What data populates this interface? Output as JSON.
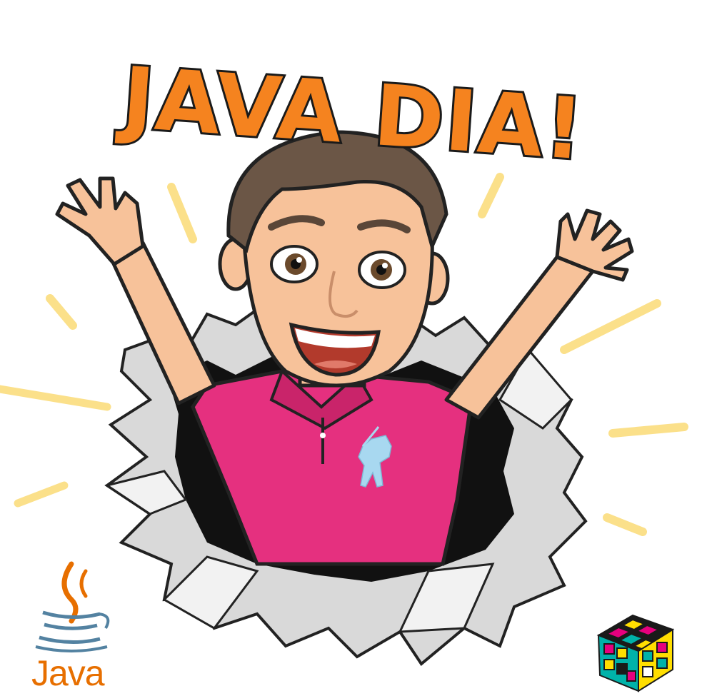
{
  "sticker": {
    "headline": "JAVA DIA!",
    "headline_color": "#f5831f",
    "shirt_color": "#e5307f",
    "polo_logo_color": "#a8d8f0",
    "ray_color": "#fbe08a",
    "paper_color": "#ffffff"
  },
  "java_logo": {
    "label": "Java",
    "cup_color": "#5382a1",
    "flame_color": "#e76f00",
    "icon": "java-coffee-cup-icon"
  },
  "corner_logo": {
    "icon": "rubiks-cube-icon",
    "colors": [
      "#e6007e",
      "#ffde00",
      "#00b2a9",
      "#1a1a1a"
    ]
  }
}
